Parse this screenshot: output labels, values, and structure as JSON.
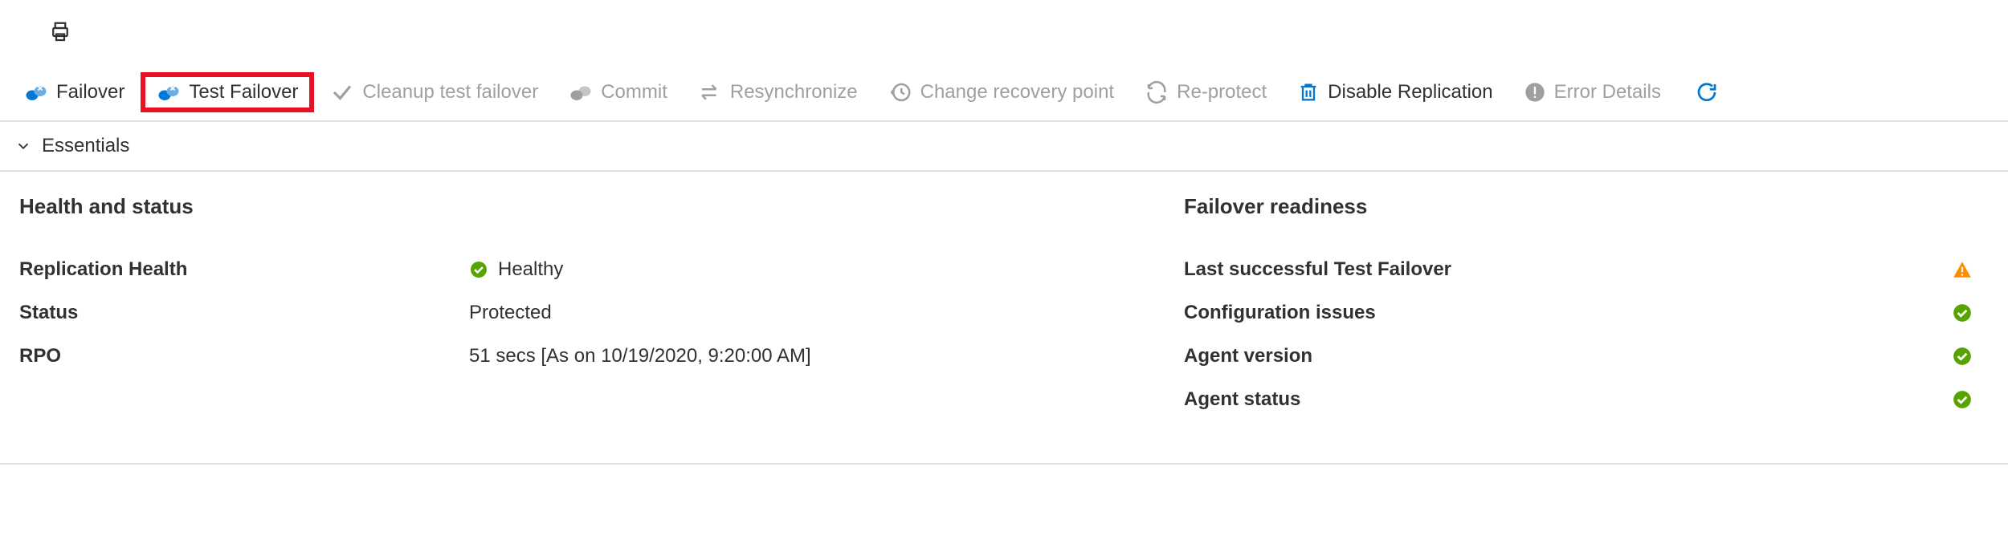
{
  "toolbar": {
    "failover": "Failover",
    "test_failover": "Test Failover",
    "cleanup": "Cleanup test failover",
    "commit": "Commit",
    "resync": "Resynchronize",
    "change_recovery": "Change recovery point",
    "reprotect": "Re-protect",
    "disable_replication": "Disable Replication",
    "error_details": "Error Details"
  },
  "essentials": {
    "label": "Essentials"
  },
  "health": {
    "title": "Health and status",
    "replication_health_label": "Replication Health",
    "replication_health_value": "Healthy",
    "status_label": "Status",
    "status_value": "Protected",
    "rpo_label": "RPO",
    "rpo_value": "51 secs [As on 10/19/2020, 9:20:00 AM]"
  },
  "readiness": {
    "title": "Failover readiness",
    "last_test": "Last successful Test Failover",
    "config_issues": "Configuration issues",
    "agent_version": "Agent version",
    "agent_status": "Agent status"
  },
  "colors": {
    "blue": "#0078d4",
    "gray": "#a19f9d",
    "green": "#57a300",
    "orange": "#ff8c00",
    "red": "#e81123",
    "darkgray": "#605e5c"
  }
}
